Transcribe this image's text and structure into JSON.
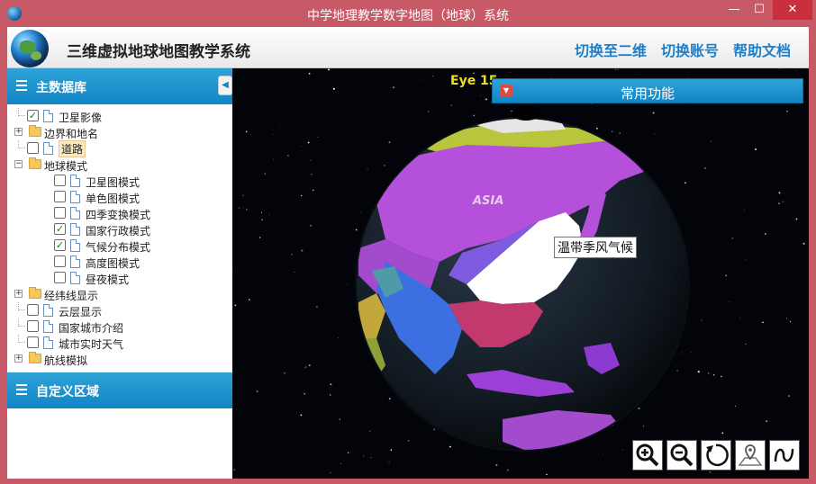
{
  "window": {
    "title": "中学地理教学数字地图（地球）系统",
    "min_symbol": "—",
    "max_symbol": "☐",
    "close_symbol": "✕"
  },
  "header": {
    "app_name": "三维虚拟地球地图教学系统",
    "links": [
      "切换至二维",
      "切换账号",
      "帮助文档"
    ],
    "link_color": "#1f7fc8"
  },
  "sidebar": {
    "main_title": "主数据库",
    "collapse_symbol": "◀",
    "custom_title": "自定义区域",
    "tree": [
      {
        "label": "卫星影像",
        "checked": true,
        "kind": "doc",
        "level": 0,
        "expander": false
      },
      {
        "label": "边界和地名",
        "kind": "folder",
        "level": 0,
        "expander": "+"
      },
      {
        "label": "道路",
        "checked": false,
        "kind": "doc",
        "level": 0,
        "expander": false,
        "selected": true
      },
      {
        "label": "地球模式",
        "kind": "folder",
        "level": 0,
        "expander": "−"
      },
      {
        "label": "卫星图模式",
        "checked": false,
        "kind": "doc",
        "level": 1
      },
      {
        "label": "单色图模式",
        "checked": false,
        "kind": "doc",
        "level": 1
      },
      {
        "label": "四季变换模式",
        "checked": false,
        "kind": "doc",
        "level": 1
      },
      {
        "label": "国家行政模式",
        "checked": true,
        "kind": "doc",
        "level": 1
      },
      {
        "label": "气候分布模式",
        "checked": true,
        "kind": "doc",
        "level": 1
      },
      {
        "label": "高度图模式",
        "checked": false,
        "kind": "doc",
        "level": 1
      },
      {
        "label": "昼夜模式",
        "checked": false,
        "kind": "doc",
        "level": 1
      },
      {
        "label": "经纬线显示",
        "kind": "folder",
        "level": 0,
        "expander": "+"
      },
      {
        "label": "云层显示",
        "checked": false,
        "kind": "doc",
        "level": 0
      },
      {
        "label": "国家城市介绍",
        "checked": false,
        "kind": "doc",
        "level": 0
      },
      {
        "label": "城市实时天气",
        "checked": false,
        "kind": "doc",
        "level": 0
      },
      {
        "label": "航线模拟",
        "kind": "folder",
        "level": 0,
        "expander": "+"
      }
    ]
  },
  "map": {
    "eye_text": "Eye 15…",
    "functions_label": "常用功能",
    "climate_label": "温带季风气候",
    "continent_label": "ASIA",
    "tools": [
      "zoom-in-icon",
      "zoom-out-icon",
      "rotate-icon",
      "location-pin-icon",
      "path-icon"
    ]
  }
}
